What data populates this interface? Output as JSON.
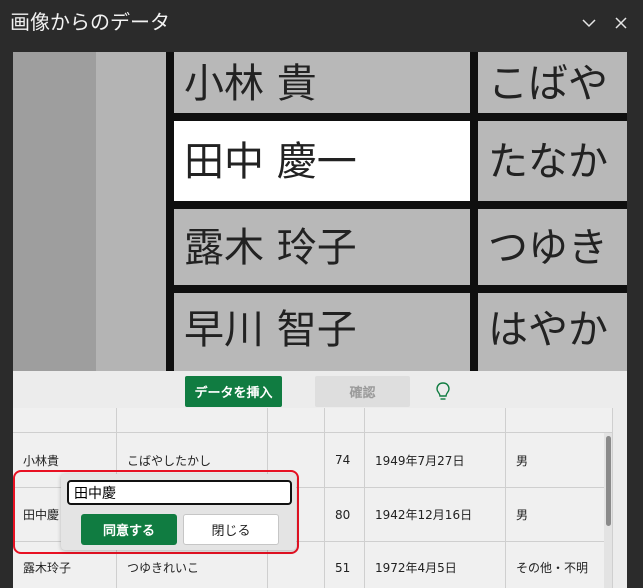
{
  "window": {
    "title": "画像からのデータ",
    "minimize_icon": "chevron-down-icon",
    "close_icon": "close-icon"
  },
  "preview": {
    "rows": [
      {
        "name": "小林 貴",
        "kana": "こばや"
      },
      {
        "name": "田中 慶一",
        "kana": "たなか"
      },
      {
        "name": "露木 玲子",
        "kana": "つゆき"
      },
      {
        "name": "早川 智子",
        "kana": "はやか"
      }
    ],
    "highlighted_row": 1
  },
  "toolbar": {
    "insert_label": "データを挿入",
    "confirm_label": "確認",
    "hint_icon": "lightbulb-icon"
  },
  "table": {
    "rows": [
      {
        "name": "",
        "kana": "",
        "age": "",
        "birth": "",
        "gender": ""
      },
      {
        "name": "小林貴",
        "kana": "こばやしたかし",
        "age": "74",
        "birth": "1949年7月27日",
        "gender": "男"
      },
      {
        "name": "田中慶",
        "kana": "",
        "age": "80",
        "birth": "1942年12月16日",
        "gender": "男"
      },
      {
        "name": "露木玲子",
        "kana": "つゆきれいこ",
        "age": "51",
        "birth": "1972年4月5日",
        "gender": "その他・不明"
      }
    ]
  },
  "popup": {
    "input_value": "田中慶",
    "agree_label": "同意する",
    "close_label": "閉じる"
  }
}
